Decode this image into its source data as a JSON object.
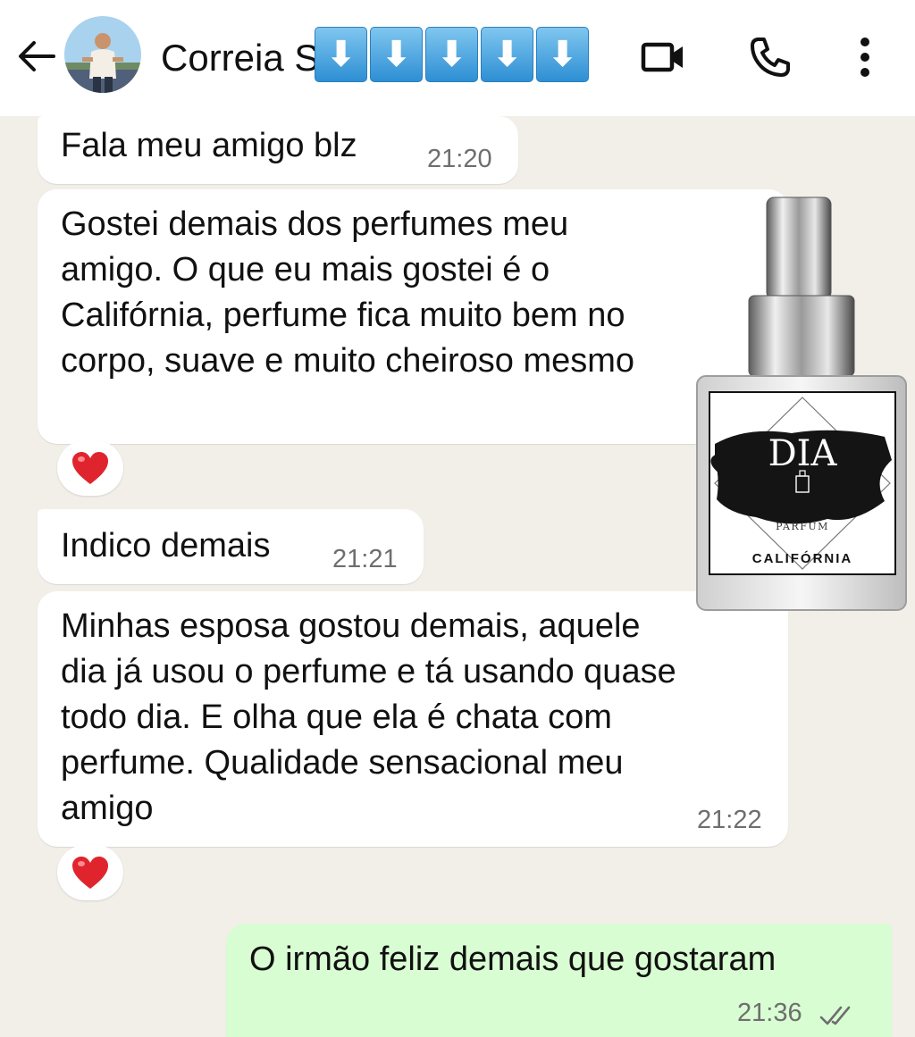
{
  "header": {
    "contact_name": "Correia S",
    "name_emoji": [
      "⬇",
      "⬇",
      "⬇",
      "⬇",
      "⬇"
    ],
    "icons": {
      "back": "arrow-left-icon",
      "video": "video-camera-icon",
      "call": "phone-icon",
      "menu": "more-vertical-icon"
    }
  },
  "messages": [
    {
      "direction": "incoming",
      "text": "Fala meu amigo blz",
      "time": "21:20"
    },
    {
      "direction": "incoming",
      "text": "Gostei demais dos perfumes meu\namigo. O que eu mais gostei é o\nCalifórnia, perfume fica muito bem no\ncorpo, suave e muito cheiroso mesmo",
      "reaction": "heart"
    },
    {
      "direction": "incoming",
      "text": "Indico demais",
      "time": "21:21"
    },
    {
      "direction": "incoming",
      "text": "Minhas esposa gostou demais, aquele\ndia já usou o perfume e tá usando quase\ntodo dia. E olha que ela é chata com\nperfume. Qualidade sensacional meu\namigo",
      "time": "21:22",
      "reaction": "heart"
    },
    {
      "direction": "outgoing",
      "text": "O irmão feliz demais que gostaram",
      "time": "21:36",
      "status": "read"
    }
  ],
  "product_image": {
    "brand": "DIA",
    "sub": "PARFUM",
    "name": "CALIFÓRNIA"
  },
  "colors": {
    "header_bg": "#ffffff",
    "chat_bg": "#f2efe9",
    "incoming_bubble": "#ffffff",
    "outgoing_bubble": "#d9fdd3",
    "time_text": "#6e6e6e",
    "reaction_heart": "#e0242e"
  }
}
